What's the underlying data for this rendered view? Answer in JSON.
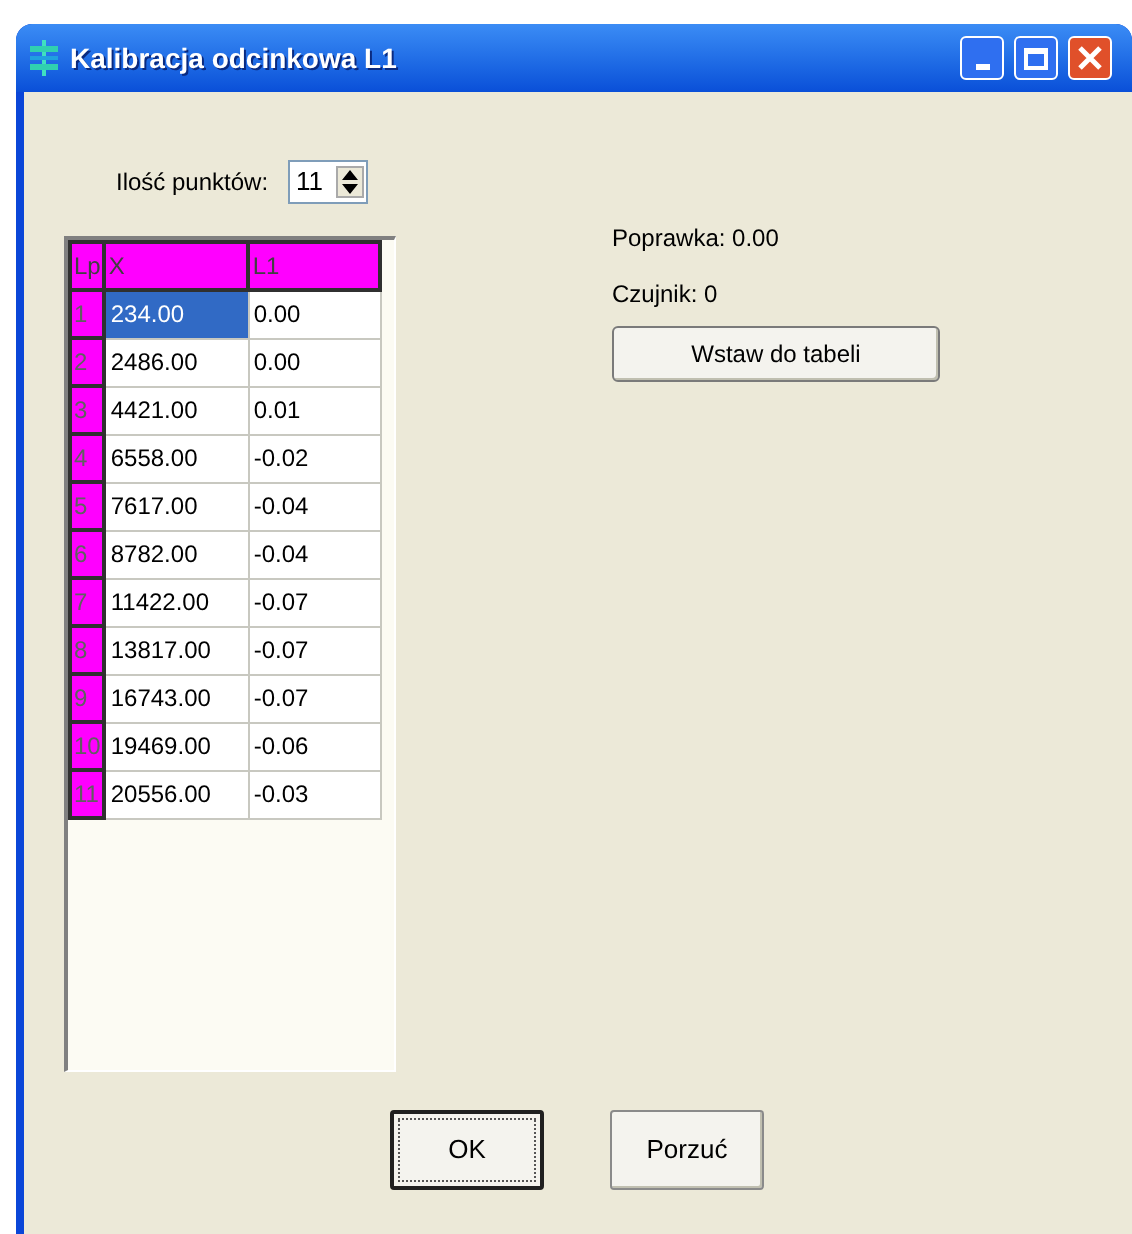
{
  "window": {
    "title": "Kalibracja odcinkowa L1"
  },
  "points": {
    "label": "Ilość punktów:",
    "value": "11"
  },
  "table": {
    "columns": [
      "Lp",
      "X",
      "L1"
    ],
    "rows": [
      {
        "cells": [
          "1",
          "234.00",
          "0.00"
        ],
        "selected": true
      },
      {
        "cells": [
          "2",
          "2486.00",
          "0.00"
        ],
        "selected": false
      },
      {
        "cells": [
          "3",
          "4421.00",
          "0.01"
        ],
        "selected": false
      },
      {
        "cells": [
          "4",
          "6558.00",
          "-0.02"
        ],
        "selected": false
      },
      {
        "cells": [
          "5",
          "7617.00",
          "-0.04"
        ],
        "selected": false
      },
      {
        "cells": [
          "6",
          "8782.00",
          "-0.04"
        ],
        "selected": false
      },
      {
        "cells": [
          "7",
          "11422.00",
          "-0.07"
        ],
        "selected": false
      },
      {
        "cells": [
          "8",
          "13817.00",
          "-0.07"
        ],
        "selected": false
      },
      {
        "cells": [
          "9",
          "16743.00",
          "-0.07"
        ],
        "selected": false
      },
      {
        "cells": [
          "10",
          "19469.00",
          "-0.06"
        ],
        "selected": false
      },
      {
        "cells": [
          "11",
          "20556.00",
          "-0.03"
        ],
        "selected": false
      }
    ]
  },
  "info": [
    "Poprawka: 0.00",
    "Czujnik: 0"
  ],
  "insert_button": "Wstaw do tabeli",
  "buttons": [
    {
      "label": "OK",
      "selected": true
    },
    {
      "label": "Porzuć",
      "selected": false
    }
  ]
}
